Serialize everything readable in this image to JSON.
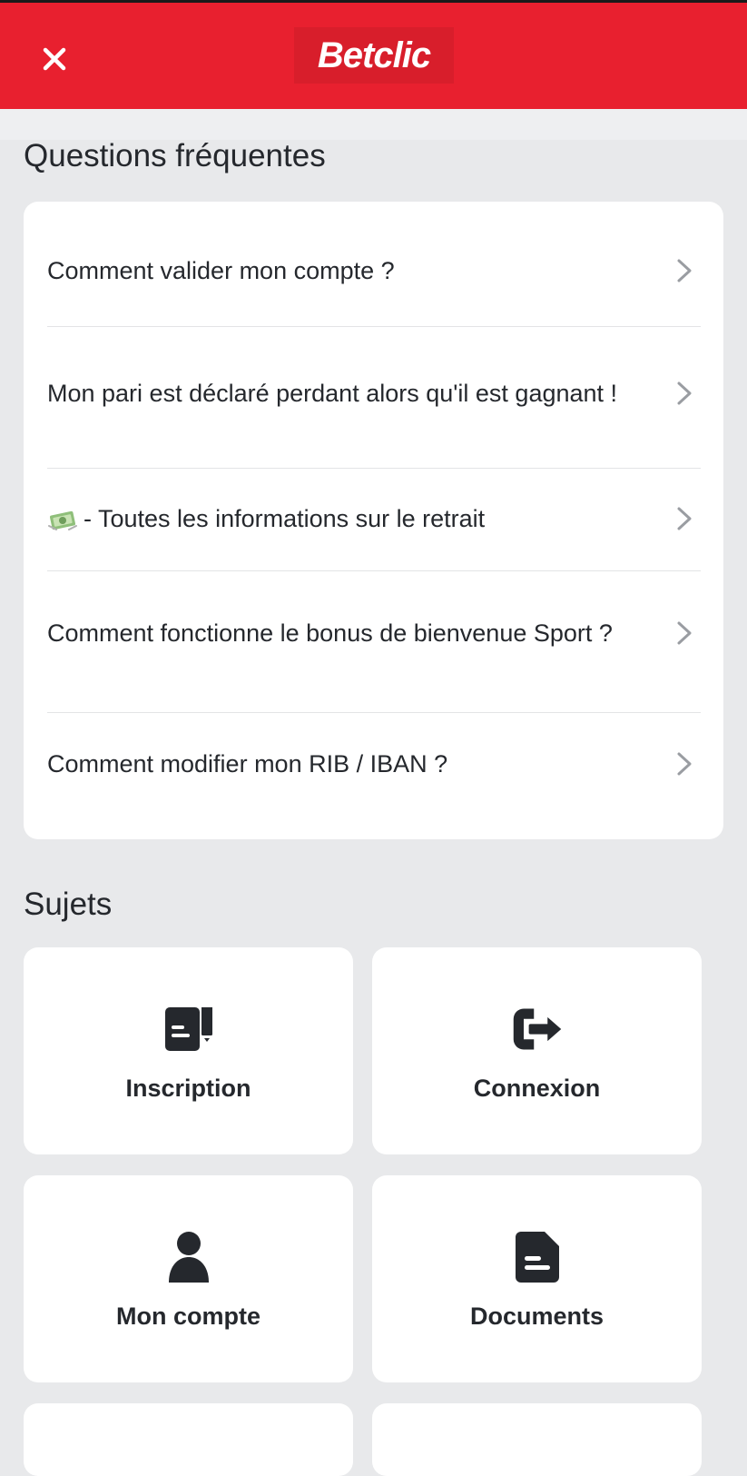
{
  "header": {
    "logo_text": "Betclic",
    "brand_color": "#e8202f"
  },
  "faq": {
    "title": "Questions fréquentes",
    "items": [
      {
        "label": "Comment valider mon compte ?"
      },
      {
        "label": "Mon pari est déclaré perdant alors qu'il est gagnant !"
      },
      {
        "label": "- Toutes les informations sur le retrait",
        "icon": "money-icon"
      },
      {
        "label": "Comment fonctionne le bonus de bienvenue Sport ?"
      },
      {
        "label": "Comment modifier mon RIB / IBAN ?"
      }
    ]
  },
  "topics": {
    "title": "Sujets",
    "items": [
      {
        "label": "Inscription",
        "icon": "registration-icon"
      },
      {
        "label": "Connexion",
        "icon": "login-icon"
      },
      {
        "label": "Mon compte",
        "icon": "user-icon"
      },
      {
        "label": "Documents",
        "icon": "document-icon"
      }
    ]
  }
}
